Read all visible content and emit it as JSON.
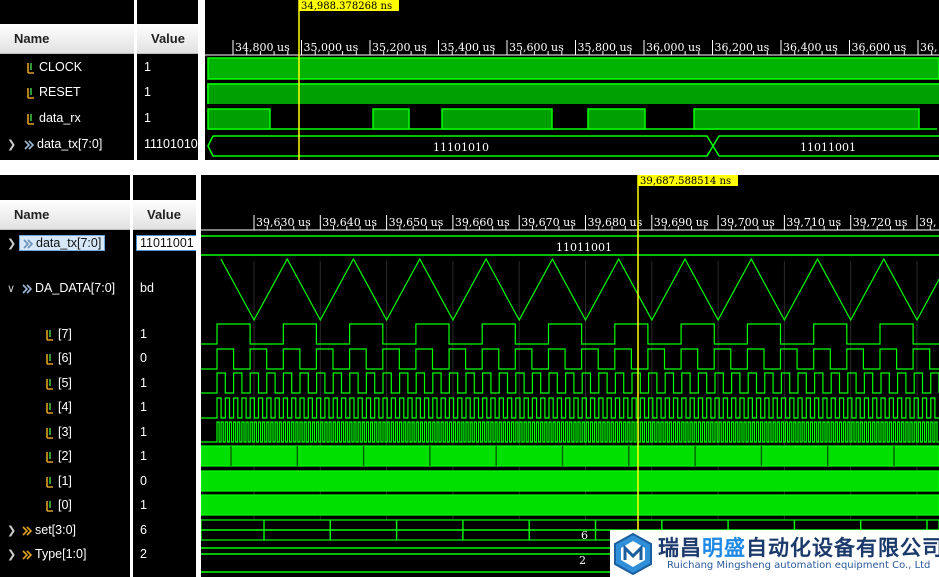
{
  "headers": {
    "name": "Name",
    "value": "Value"
  },
  "panel1": {
    "cursor_label": "34,988.378268 ns",
    "ticks": [
      "34,800 us",
      "35,000 us",
      "35,200 us",
      "35,400 us",
      "35,600 us",
      "35,800 us",
      "36,000 us",
      "36,200 us",
      "36,400 us",
      "36,600 us",
      "36,"
    ],
    "signals": [
      {
        "name": "CLOCK",
        "value": "1"
      },
      {
        "name": "RESET",
        "value": "1"
      },
      {
        "name": "data_rx",
        "value": "1"
      },
      {
        "name": "data_tx[7:0]",
        "value": "11101010"
      }
    ],
    "bus_labels": [
      "11101010",
      "11011001"
    ]
  },
  "panel2": {
    "cursor_label": "39,687.588514 ns",
    "ticks": [
      "39,630 us",
      "39,640 us",
      "39,650 us",
      "39,660 us",
      "39,670 us",
      "39,680 us",
      "39,690 us",
      "39,700 us",
      "39,710 us",
      "39,720 us",
      "39,"
    ],
    "signals": [
      {
        "name": "data_tx[7:0]",
        "value": "11011001"
      },
      {
        "name": "DA_DATA[7:0]",
        "value": "bd"
      },
      {
        "name": "[7]",
        "value": "1"
      },
      {
        "name": "[6]",
        "value": "0"
      },
      {
        "name": "[5]",
        "value": "1"
      },
      {
        "name": "[4]",
        "value": "1"
      },
      {
        "name": "[3]",
        "value": "1"
      },
      {
        "name": "[2]",
        "value": "1"
      },
      {
        "name": "[1]",
        "value": "0"
      },
      {
        "name": "[0]",
        "value": "1"
      },
      {
        "name": "set[3:0]",
        "value": "6"
      },
      {
        "name": "Type[1:0]",
        "value": "2"
      }
    ],
    "bus_labels": {
      "data_tx": "11011001",
      "set": "6",
      "type": "2"
    }
  },
  "watermark": {
    "chinese_a": "瑞昌",
    "chinese_b": "明盛",
    "chinese_c": "自动化设备有限公司",
    "english": "Ruichang Mingsheng automation equipment Co., Ltd"
  },
  "colors": {
    "wave": "#00ff00",
    "wave_fill": "#00b300",
    "cursor": "#ffff00",
    "background": "#000000",
    "ruler": "#ffffff"
  },
  "icons": {
    "single_bit": "signal-bit-icon",
    "bus": "bus-icon"
  }
}
